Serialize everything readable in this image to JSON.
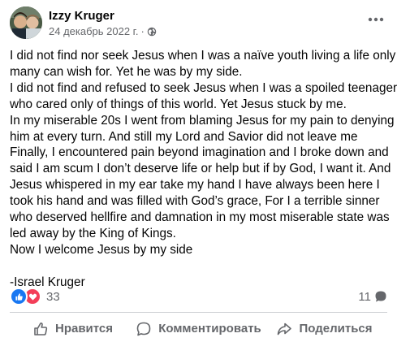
{
  "post": {
    "author": "Izzy Kruger",
    "date": "24 декабрь 2022 г.",
    "privacy_icon": "globe-icon",
    "menu_icon": "more-horizontal-icon",
    "body_lines": [
      "I did not find nor seek Jesus when I was a naïve youth living a life only",
      "many can wish for. Yet he was by my side.",
      "I did not find and refused to seek Jesus when I was a spoiled teenager",
      "who cared only of things of this world. Yet Jesus stuck by me.",
      "In my miserable 20s I went from blaming Jesus for my pain to denying",
      "him at every turn. And still my Lord and Savior did not leave me",
      "Finally, I encountered pain beyond imagination and I broke down and",
      "said I am scum I don’t deserve life or help but if by God, I want it. And",
      "Jesus whispered in my ear take my hand I have always been here I",
      "took his hand and was filled with God’s grace, For I a terrible sinner",
      "who deserved hellfire and damnation in my most miserable state was",
      "led away by the King of Kings.",
      "Now I welcome Jesus by my side"
    ],
    "signature": "-Israel Kruger"
  },
  "stats": {
    "reaction_count": "33",
    "reaction_icons": [
      "like-icon",
      "love-icon"
    ],
    "comment_count": "11"
  },
  "actions": {
    "like_label": "Нравится",
    "comment_label": "Комментировать",
    "share_label": "Поделиться"
  },
  "colors": {
    "text": "#050505",
    "secondary_text": "#65676b",
    "like_blue": "#1877f2",
    "love_red": "#f33e58",
    "divider": "#ced0d4"
  }
}
